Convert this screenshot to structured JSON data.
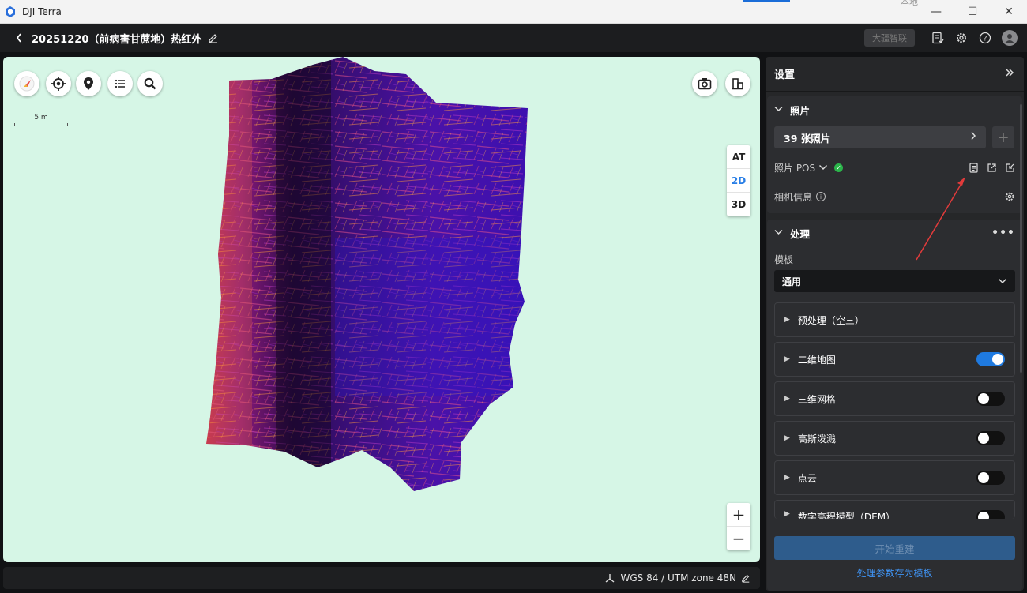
{
  "window": {
    "app_title": "DJI Terra",
    "ghost_tab_text": "本地",
    "controls": {
      "minimize": "—",
      "maximize": "☐",
      "close": "✕"
    }
  },
  "header": {
    "back": "‹",
    "project_title": "20251220（前病害甘蔗地）热红外",
    "bigmap_button": "大疆智联"
  },
  "map": {
    "scale_label": "5 m",
    "view_modes": [
      "AT",
      "2D",
      "3D"
    ],
    "active_view": "2D",
    "zoom_in": "+",
    "zoom_out": "−",
    "background_color": "#d6f6e6"
  },
  "status_bar": {
    "crs": "WGS 84 / UTM zone 48N"
  },
  "panel": {
    "title": "设置",
    "photos": {
      "section_title": "照片",
      "count_label": "39 张照片",
      "add": "+",
      "pos_label": "照片 POS",
      "camera_info_label": "相机信息"
    },
    "process": {
      "section_title": "处理",
      "template_label": "模板",
      "template_value": "通用",
      "steps": [
        {
          "label": "预处理（空三）",
          "toggle": null
        },
        {
          "label": "二维地图",
          "toggle": true
        },
        {
          "label": "三维网格",
          "toggle": false
        },
        {
          "label": "高斯泼溅",
          "toggle": false
        },
        {
          "label": "点云",
          "toggle": false
        },
        {
          "label": "数字高程模型（DEM）",
          "toggle": false
        }
      ]
    },
    "start_button": "开始重建",
    "save_template_link": "处理参数存为模板"
  },
  "colors": {
    "accent": "#1f7ae0",
    "link": "#3f94f5",
    "success": "#2bb44a",
    "annotation_arrow": "#e23b3b"
  }
}
